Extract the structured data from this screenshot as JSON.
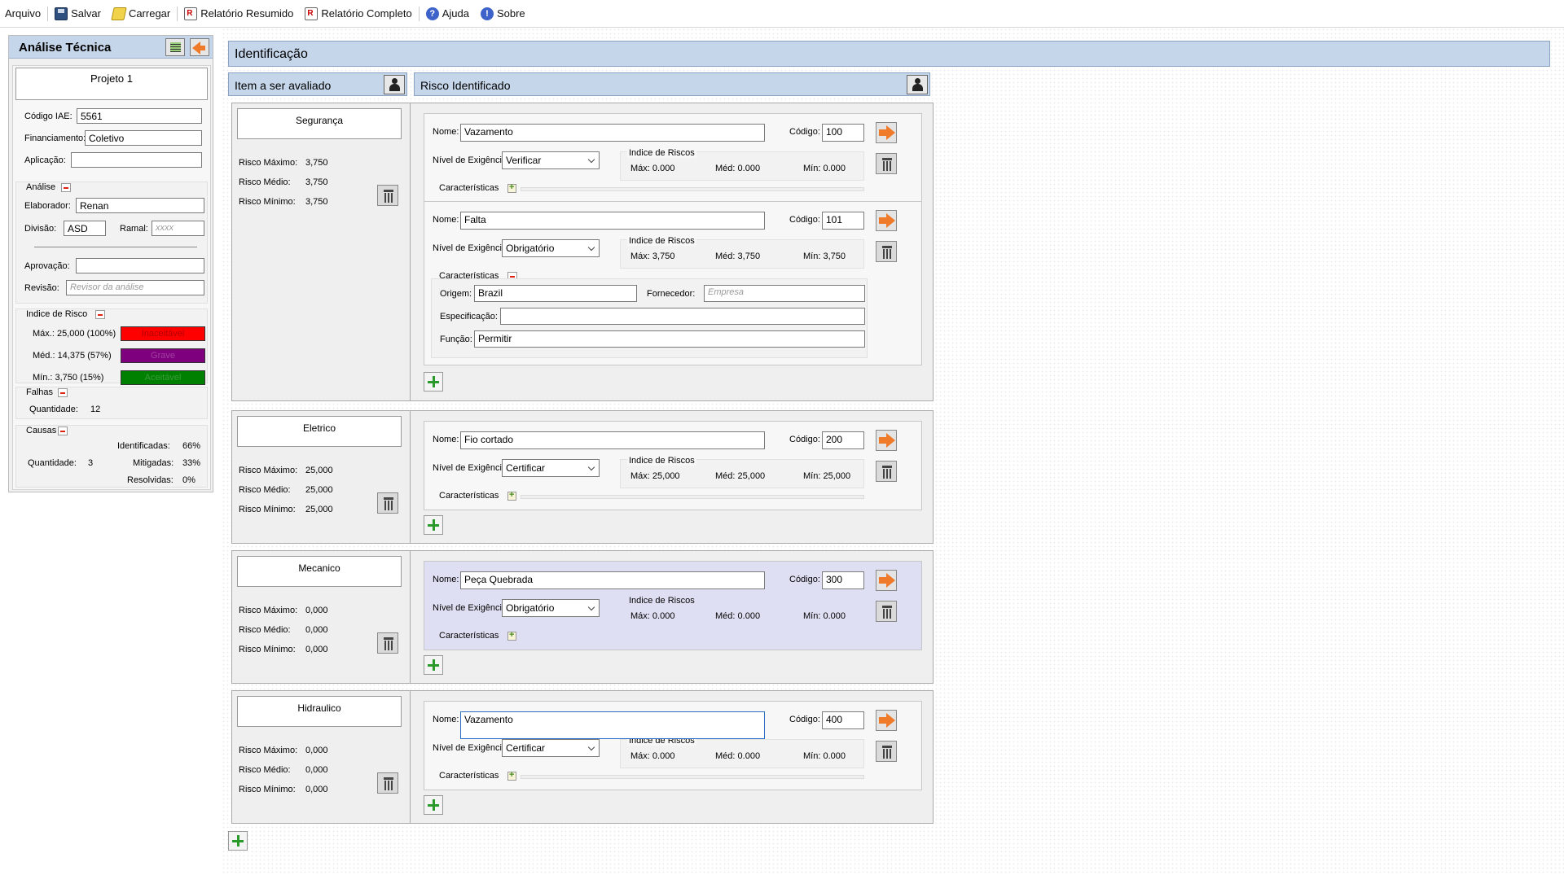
{
  "menu": {
    "arquivo": "Arquivo",
    "salvar": "Salvar",
    "carregar": "Carregar",
    "relatorio_resumido": "Relatório Resumido",
    "relatorio_completo": "Relatório Completo",
    "ajuda": "Ajuda",
    "sobre": "Sobre"
  },
  "left": {
    "title": "Análise Técnica",
    "project_name": "Projeto 1",
    "codigo_label": "Código IAE:",
    "codigo_value": "5561",
    "financiamento_label": "Financiamento:",
    "financiamento_value": "Coletivo",
    "aplicacao_label": "Aplicação:",
    "aplicacao_value": "",
    "analise_section": "Análise",
    "elaborador_label": "Elaborador:",
    "elaborador_value": "Renan",
    "divisao_label": "Divisão:",
    "divisao_value": "ASD",
    "ramal_label": "Ramal:",
    "ramal_placeholder": "xxxx",
    "aprovacao_label": "Aprovação:",
    "aprovacao_value": "",
    "revisao_label": "Revisão:",
    "revisao_placeholder": "Revisor da análise",
    "indice_section": "Indice de Risco",
    "max_text": "Máx.: 25,000 (100%)",
    "med_text": "Méd.: 14,375 (57%)",
    "min_text": "Mín.: 3,750 (15%)",
    "max_badge": "Inaceitável",
    "med_badge": "Grave",
    "min_badge": "Aceitável",
    "colors": {
      "max": "#ff0000",
      "med": "#7f007f",
      "min": "#008000"
    },
    "falhas_section": "Falhas",
    "falhas_qtd_label": "Quantidade:",
    "falhas_qtd_value": "12",
    "causas_section": "Causas",
    "causas_qtd_label": "Quantidade:",
    "causas_qtd_value": "3",
    "identificadas_label": "Identificadas:",
    "identificadas_value": "66%",
    "mitigadas_label": "Mitigadas:",
    "mitigadas_value": "33%",
    "resolvidas_label": "Resolvidas:",
    "resolvidas_value": "0%"
  },
  "main": {
    "title": "Identificação",
    "col_item": "Item a ser avaliado",
    "col_risco": "Risco Identificado",
    "labels": {
      "risco_maximo": "Risco Máximo:",
      "risco_medio": "Risco Médio:",
      "risco_minimo": "Risco Mínimo:",
      "nome": "Nome:",
      "codigo": "Código:",
      "nivel": "Nível de Exigência:",
      "indice": "Indice de Riscos",
      "max": "Máx:",
      "med": "Méd:",
      "min": "Mín:",
      "caracteristicas": "Características",
      "origem": "Origem:",
      "fornecedor": "Fornecedor:",
      "especificacao": "Especificação:",
      "funcao": "Função:"
    },
    "sections": [
      {
        "item": "Segurança",
        "max": "3,750",
        "med": "3,750",
        "min": "3,750",
        "risks": [
          {
            "nome": "Vazamento",
            "codigo": "100",
            "nivel": "Verificar",
            "rmax": "0.000",
            "rmed": "0.000",
            "rmin": "0.000"
          },
          {
            "nome": "Falta",
            "codigo": "101",
            "nivel": "Obrigatório",
            "rmax": "3,750",
            "rmed": "3,750",
            "rmin": "3,750",
            "origem": "Brazil",
            "fornecedor_placeholder": "Empresa",
            "especificacao": "",
            "funcao": "Permitir"
          }
        ]
      },
      {
        "item": "Eletrico",
        "max": "25,000",
        "med": "25,000",
        "min": "25,000",
        "risks": [
          {
            "nome": "Fio cortado",
            "codigo": "200",
            "nivel": "Certificar",
            "rmax": "25,000",
            "rmed": "25,000",
            "rmin": "25,000"
          }
        ]
      },
      {
        "item": "Mecanico",
        "max": "0,000",
        "med": "0,000",
        "min": "0,000",
        "risks": [
          {
            "nome": "Peça Quebrada",
            "codigo": "300",
            "nivel": "Obrigatório",
            "rmax": "0.000",
            "rmed": "0.000",
            "rmin": "0.000"
          }
        ]
      },
      {
        "item": "Hidraulico",
        "max": "0,000",
        "med": "0,000",
        "min": "0,000",
        "risks": [
          {
            "nome": "Vazamento",
            "codigo": "400",
            "nivel": "Certificar",
            "rmax": "0.000",
            "rmed": "0.000",
            "rmin": "0.000"
          }
        ]
      }
    ]
  }
}
